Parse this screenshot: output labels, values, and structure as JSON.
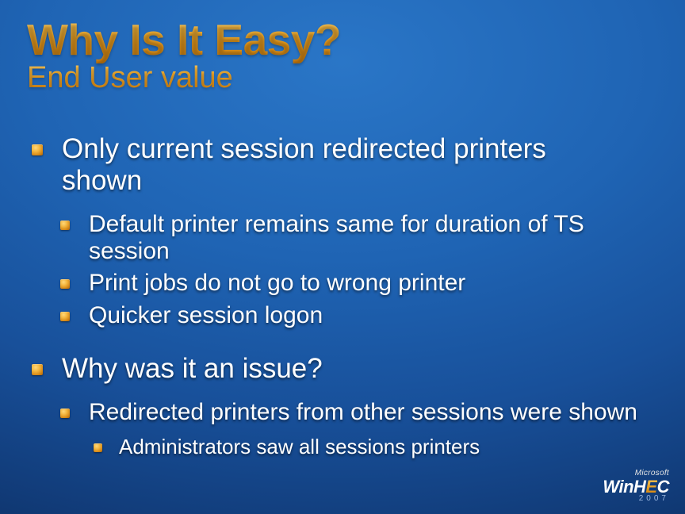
{
  "title": "Why Is It Easy?",
  "subtitle": "End User value",
  "bullets": {
    "l1_a": "Only current session redirected printers shown",
    "l2_a": "Default printer remains same for duration of TS session",
    "l2_b": "Print jobs do not go to wrong printer",
    "l2_c": "Quicker session logon",
    "l1_b": "Why was it an issue?",
    "l2_d": "Redirected printers from other sessions were shown",
    "l3_a": "Administrators saw all sessions printers"
  },
  "footer": {
    "company": "Microsoft",
    "brand_prefix": "Win",
    "brand_mid": "H",
    "brand_e": "E",
    "brand_suffix": "C",
    "year": "2007"
  }
}
